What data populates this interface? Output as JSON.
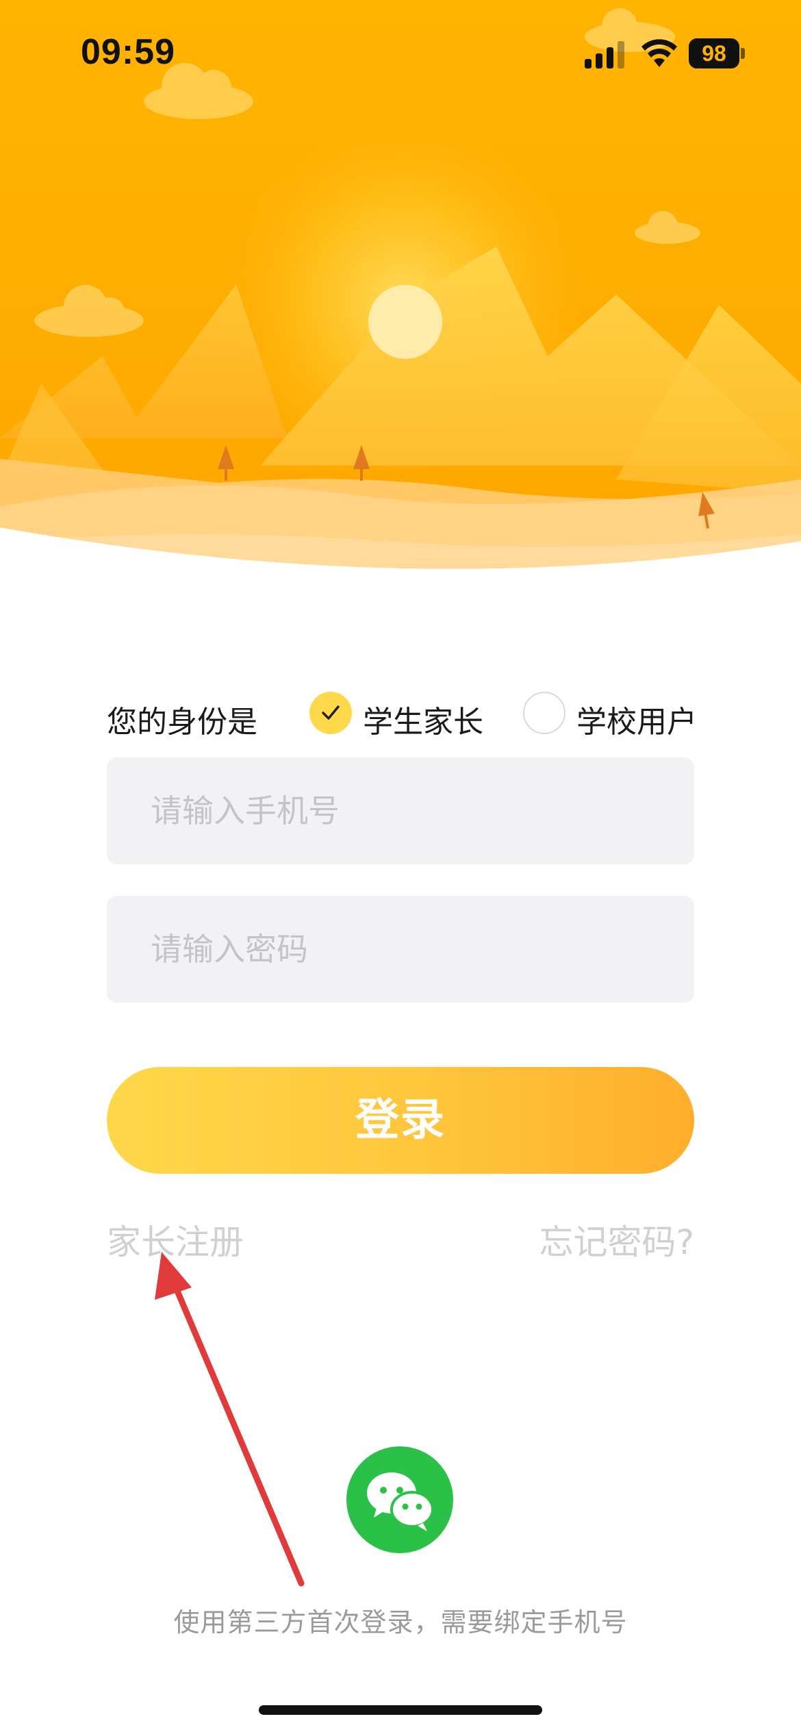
{
  "status_bar": {
    "time": "09:59",
    "battery_level": "98",
    "icons": [
      "signal-icon",
      "wifi-icon",
      "battery-icon"
    ]
  },
  "hero": {
    "illustration": "mountain-sun-landscape",
    "colors": {
      "sky_top": "#FFB300",
      "sky_bottom": "#FFA000",
      "mountain": "#FFC940",
      "sun": "#FFE9A8"
    }
  },
  "identity": {
    "label": "您的身份是",
    "options": [
      {
        "label": "学生家长",
        "selected": true
      },
      {
        "label": "学校用户",
        "selected": false
      }
    ]
  },
  "form": {
    "phone_placeholder": "请输入手机号",
    "phone_value": "",
    "password_placeholder": "请输入密码",
    "password_value": ""
  },
  "login_button": {
    "label": "登录",
    "gradient": [
      "#FFD84A",
      "#FFAE2C"
    ]
  },
  "links": {
    "register": "家长注册",
    "forgot": "忘记密码?"
  },
  "third_party": {
    "icon": "wechat-icon",
    "color": "#2BC148",
    "note": "使用第三方首次登录，需要绑定手机号"
  },
  "annotation": {
    "type": "arrow",
    "color": "#E03A3A",
    "points_to": "家长注册"
  }
}
